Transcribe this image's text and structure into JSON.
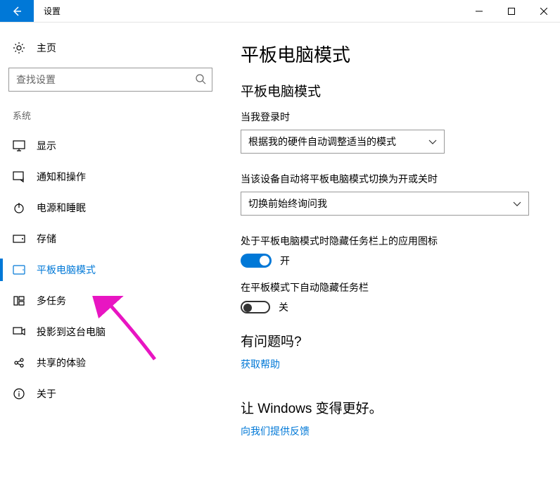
{
  "window": {
    "title": "设置"
  },
  "sidebar": {
    "home": "主页",
    "search_placeholder": "查找设置",
    "category": "系统",
    "items": [
      {
        "label": "显示"
      },
      {
        "label": "通知和操作"
      },
      {
        "label": "电源和睡眠"
      },
      {
        "label": "存储"
      },
      {
        "label": "平板电脑模式"
      },
      {
        "label": "多任务"
      },
      {
        "label": "投影到这台电脑"
      },
      {
        "label": "共享的体验"
      },
      {
        "label": "关于"
      }
    ]
  },
  "main": {
    "title": "平板电脑模式",
    "section_title": "平板电脑模式",
    "field1_label": "当我登录时",
    "field1_value": "根据我的硬件自动调整适当的模式",
    "field2_label": "当该设备自动将平板电脑模式切换为开或关时",
    "field2_value": "切换前始终询问我",
    "toggle1_label": "处于平板电脑模式时隐藏任务栏上的应用图标",
    "toggle1_state": "开",
    "toggle2_label": "在平板模式下自动隐藏任务栏",
    "toggle2_state": "关",
    "help_heading": "有问题吗?",
    "help_link": "获取帮助",
    "feedback_heading": "让 Windows 变得更好。",
    "feedback_link": "向我们提供反馈"
  }
}
